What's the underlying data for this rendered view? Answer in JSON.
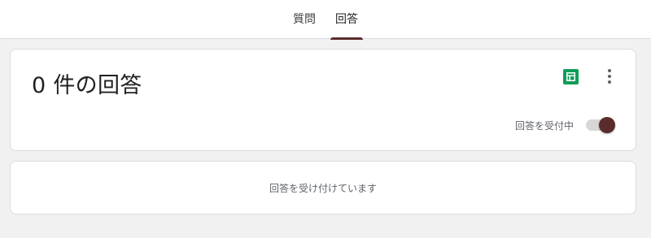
{
  "tabs": [
    {
      "label": "質問",
      "active": false
    },
    {
      "label": "回答",
      "active": true
    }
  ],
  "summary": {
    "title": "0 件の回答",
    "sheets_icon": "google-sheets-icon",
    "more_icon": "more-vertical-icon",
    "accepting_label": "回答を受付中",
    "accepting_responses": true
  },
  "status": {
    "message": "回答を受け付けています"
  },
  "colors": {
    "accent": "#5b2c2c",
    "sheets_green": "#0f9d58",
    "background": "#f1f1f1"
  }
}
